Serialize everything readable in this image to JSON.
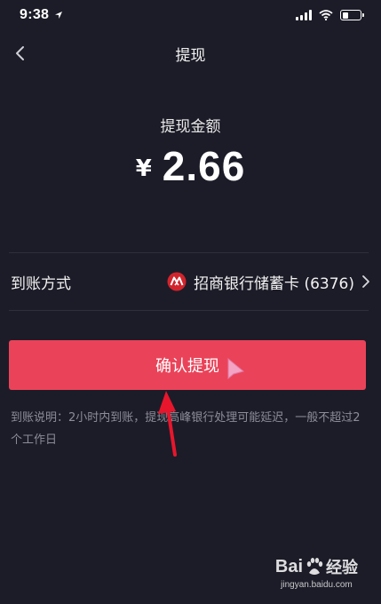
{
  "status_bar": {
    "time": "9:38",
    "icons": [
      "location-arrow-icon",
      "signal-icon",
      "wifi-icon",
      "battery-icon"
    ]
  },
  "nav": {
    "back_icon": "chevron-left-icon",
    "title": "提现"
  },
  "withdraw": {
    "amount_label": "提现金额",
    "currency_symbol": "¥",
    "amount": "2.66"
  },
  "account": {
    "label": "到账方式",
    "bank_icon": "cmb-bank-logo-icon",
    "bank_name": "招商银行储蓄卡 (6376)",
    "chevron_icon": "chevron-right-icon"
  },
  "confirm_button": {
    "label": "确认提现"
  },
  "notice": {
    "text": "到账说明：2小时内到账，提现高峰银行处理可能延迟，一般不超过2个工作日"
  },
  "watermark": {
    "brand_text": "Bai",
    "brand_suffix": "经验",
    "url": "jingyan.baidu.com"
  },
  "colors": {
    "background": "#1c1c28",
    "button": "#ea4359",
    "annotation_arrow": "#e8162c",
    "bank_logo": "#d2242c"
  }
}
